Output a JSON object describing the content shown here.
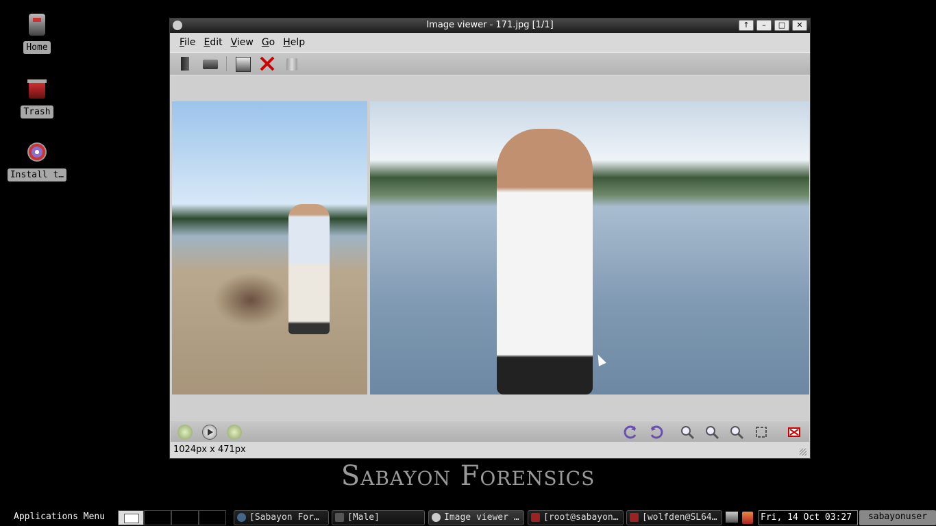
{
  "desktop": {
    "icons": [
      {
        "label": "Home",
        "icon": "home-icon"
      },
      {
        "label": "Trash",
        "icon": "trash-icon"
      },
      {
        "label": "Install t…",
        "icon": "install-disc-icon"
      }
    ]
  },
  "window": {
    "title": "Image viewer - 171.jpg [1/1]",
    "controls": [
      "↑",
      "–",
      "□",
      "✕"
    ],
    "menu": [
      {
        "label": "File",
        "accel": "F",
        "rest": "ile"
      },
      {
        "label": "Edit",
        "accel": "E",
        "rest": "dit"
      },
      {
        "label": "View",
        "accel": "V",
        "rest": "iew"
      },
      {
        "label": "Go",
        "accel": "G",
        "rest": "o"
      },
      {
        "label": "Help",
        "accel": "H",
        "rest": "elp"
      }
    ],
    "toolbar_icons": [
      "open-folder-icon",
      "open-dir-icon",
      "save-as-icon",
      "close-image-icon",
      "delete-icon"
    ],
    "status": "1024px x 471px"
  },
  "wallpaper": {
    "brand": "Sabayon Forensics"
  },
  "taskbar": {
    "apps_menu": "Applications Menu",
    "tasks": [
      {
        "label": "[Sabayon For…",
        "active": false
      },
      {
        "label": "[Male]",
        "active": false
      },
      {
        "label": "Image viewer …",
        "active": true
      },
      {
        "label": "[root@sabayon…",
        "active": false
      },
      {
        "label": "[wolfden@SL64…",
        "active": false
      }
    ],
    "clock": "Fri, 14 Oct  03:27",
    "user": "sabayonuser"
  }
}
